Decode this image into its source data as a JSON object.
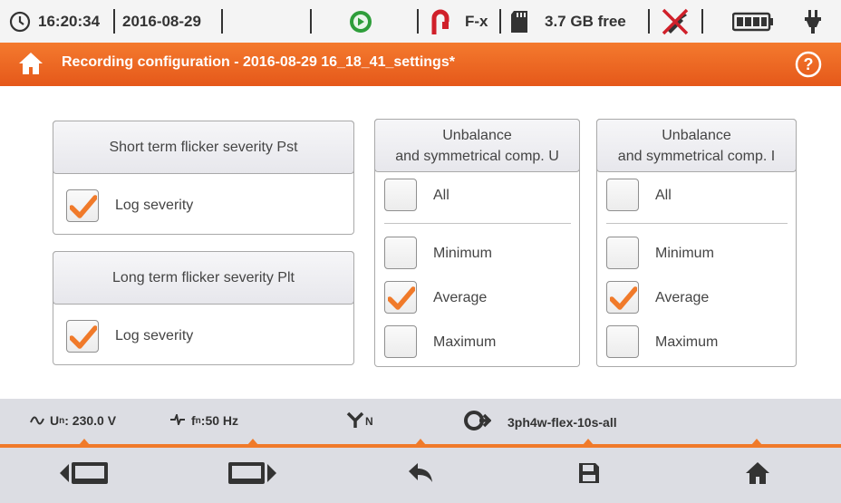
{
  "status": {
    "time": "16:20:34",
    "date": "2016-08-29",
    "clamp_label": "F-x",
    "storage_free": "3.7 GB free"
  },
  "header": {
    "title": "Recording configuration - 2016-08-29 16_18_41_settings*"
  },
  "panels": {
    "pst": {
      "title": "Short term flicker severity Pst",
      "log_label": "Log severity",
      "log_checked": true
    },
    "plt": {
      "title": "Long term flicker severity Plt",
      "log_label": "Log severity",
      "log_checked": true
    },
    "unb_u": {
      "title_line1": "Unbalance",
      "title_line2": "and symmetrical comp. U",
      "all_label": "All",
      "min_label": "Minimum",
      "avg_label": "Average",
      "max_label": "Maximum",
      "all_checked": false,
      "min_checked": false,
      "avg_checked": true,
      "max_checked": false
    },
    "unb_i": {
      "title_line1": "Unbalance",
      "title_line2": "and symmetrical comp. I",
      "all_label": "All",
      "min_label": "Minimum",
      "avg_label": "Average",
      "max_label": "Maximum",
      "all_checked": false,
      "min_checked": false,
      "avg_checked": true,
      "max_checked": false
    }
  },
  "infobar": {
    "un_label": "U",
    "un_sub": "n",
    "un_value": ": 230.0 V",
    "fn_label": "f",
    "fn_sub": "n",
    "fn_value": ":50 Hz",
    "network_sub": "N",
    "profile": "3ph4w-flex-10s-all"
  },
  "colors": {
    "accent": "#f07a2a",
    "check": "#f07a2a",
    "bar_bg": "#dcdde3"
  }
}
